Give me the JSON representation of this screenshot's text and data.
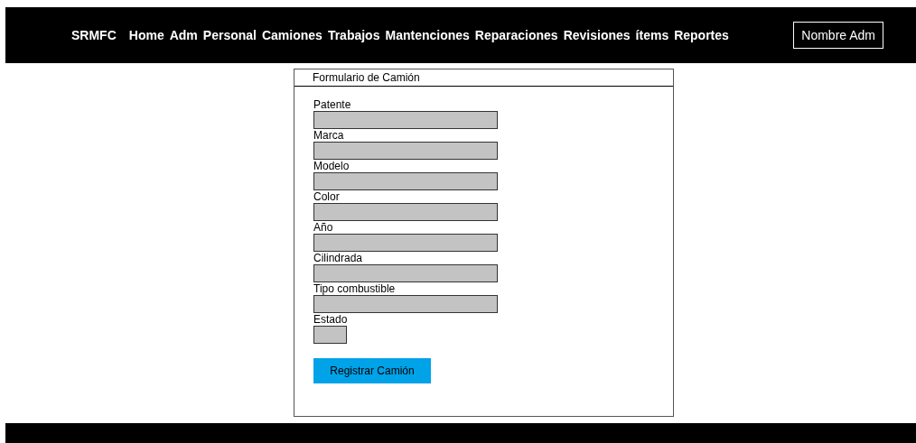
{
  "header": {
    "brand": "SRMFC",
    "nav": [
      "Home",
      "Adm",
      "Personal",
      "Camiones",
      "Trabajos",
      "Mantenciones",
      "Reparaciones",
      "Revisiones",
      "ítems",
      "Reportes"
    ],
    "user_button": "Nombre Adm"
  },
  "form": {
    "title": "Formulario de Camión",
    "fields": [
      {
        "label": "Patente",
        "kind": "wide"
      },
      {
        "label": "Marca",
        "kind": "wide"
      },
      {
        "label": "Modelo",
        "kind": "wide"
      },
      {
        "label": "Color",
        "kind": "wide"
      },
      {
        "label": "Año",
        "kind": "wide"
      },
      {
        "label": "Cilindrada",
        "kind": "wide"
      },
      {
        "label": "Tipo combustible",
        "kind": "wide"
      },
      {
        "label": "Estado",
        "kind": "short"
      }
    ],
    "submit": "Registrar Camión"
  }
}
